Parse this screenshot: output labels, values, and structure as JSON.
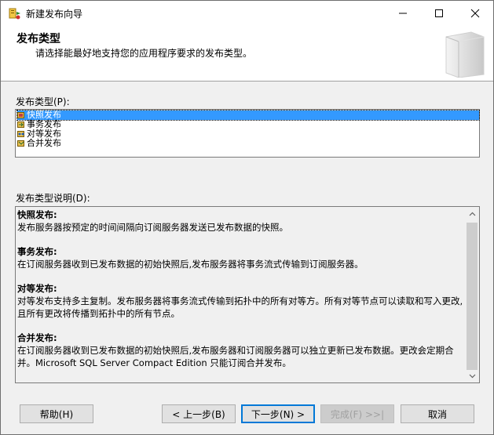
{
  "window": {
    "title": "新建发布向导"
  },
  "header": {
    "title": "发布类型",
    "description": "请选择能最好地支持您的应用程序要求的发布类型。"
  },
  "publication_types": {
    "label": "发布类型(P):",
    "items": [
      {
        "label": "快照发布",
        "icon": "snapshot-publication-icon",
        "selected": true
      },
      {
        "label": "事务发布",
        "icon": "transactional-publication-icon",
        "selected": false
      },
      {
        "label": "对等发布",
        "icon": "peer-to-peer-publication-icon",
        "selected": false
      },
      {
        "label": "合并发布",
        "icon": "merge-publication-icon",
        "selected": false
      }
    ]
  },
  "description": {
    "label": "发布类型说明(D):",
    "sections": [
      {
        "heading": "快照发布:",
        "body": "发布服务器按预定的时间间隔向订阅服务器发送已发布数据的快照。"
      },
      {
        "heading": "事务发布:",
        "body": "在订阅服务器收到已发布数据的初始快照后,发布服务器将事务流式传输到订阅服务器。"
      },
      {
        "heading": "对等发布:",
        "body": "对等发布支持多主复制。发布服务器将事务流式传输到拓扑中的所有对等方。所有对等节点可以读取和写入更改,且所有更改将传播到拓扑中的所有节点。"
      },
      {
        "heading": "合并发布:",
        "body": "在订阅服务器收到已发布数据的初始快照后,发布服务器和订阅服务器可以独立更新已发布数据。更改会定期合并。Microsoft SQL Server Compact Edition 只能订阅合并发布。"
      }
    ]
  },
  "buttons": {
    "help": "帮助(H)",
    "back": "< 上一步(B)",
    "next": "下一步(N) >",
    "finish": "完成(F) >>|",
    "cancel": "取消"
  },
  "colors": {
    "selection": "#3399ff",
    "primary_border": "#0078d7"
  }
}
